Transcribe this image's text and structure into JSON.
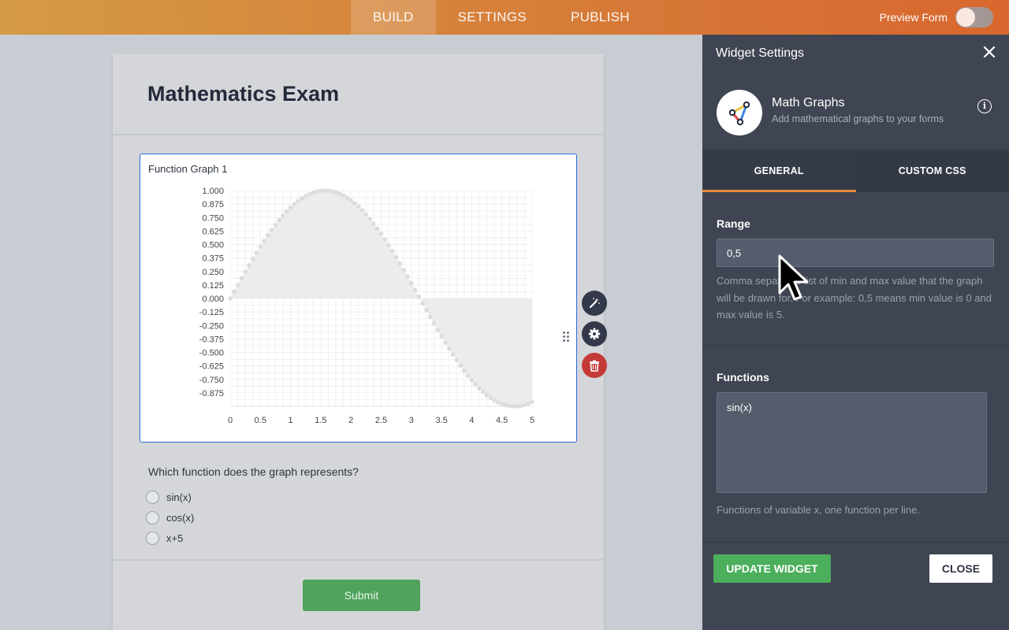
{
  "topbar": {
    "tabs": [
      {
        "label": "BUILD",
        "active": true
      },
      {
        "label": "SETTINGS",
        "active": false
      },
      {
        "label": "PUBLISH",
        "active": false
      }
    ],
    "preview_label": "Preview Form",
    "preview_enabled": false
  },
  "form": {
    "title": "Mathematics Exam",
    "widget_label": "Function Graph 1",
    "question": "Which function does the graph represents?",
    "options": [
      "sin(x)",
      "cos(x)",
      "x+5"
    ],
    "submit_label": "Submit"
  },
  "tools": {
    "wand_icon": "magic-wand-icon",
    "settings_icon": "gear-icon",
    "delete_icon": "trash-icon"
  },
  "panel": {
    "title": "Widget Settings",
    "widget_name": "Math Graphs",
    "widget_desc": "Add mathematical graphs to your forms",
    "tabs": [
      {
        "label": "GENERAL",
        "active": true
      },
      {
        "label": "CUSTOM CSS",
        "active": false
      }
    ],
    "range_label": "Range",
    "range_value": "0,5",
    "range_help": "Comma separated list of min and max value that the graph will be drawn for. For example: 0,5 means min value is 0 and max value is 5.",
    "functions_label": "Functions",
    "functions_value": "sin(x)",
    "functions_help": "Functions of variable x, one function per line.",
    "update_label": "UPDATE WIDGET",
    "close_label": "CLOSE"
  },
  "colors": {
    "accent": "#e8893d",
    "widget_border": "#2b6bd8",
    "submit": "#4fa35b",
    "update": "#4caf5c",
    "delete": "#c33a37"
  },
  "chart_data": {
    "type": "scatter",
    "function": "sin(x)",
    "x_min": 0,
    "x_max": 5,
    "x_step": 0.0625,
    "xlim": [
      0,
      5
    ],
    "ylim": [
      -1,
      1
    ],
    "x_ticks": [
      "0",
      "0.5",
      "1",
      "1.5",
      "2",
      "2.5",
      "3",
      "3.5",
      "4",
      "4.5",
      "5"
    ],
    "y_ticks": [
      "1.000",
      "0.875",
      "0.750",
      "0.625",
      "0.500",
      "0.375",
      "0.250",
      "0.125",
      "0.000",
      "-0.125",
      "-0.250",
      "-0.375",
      "-0.500",
      "-0.625",
      "-0.750",
      "-0.875"
    ],
    "grid": true,
    "fill_color": "#ececec",
    "point_color": "#dcdcdc"
  }
}
